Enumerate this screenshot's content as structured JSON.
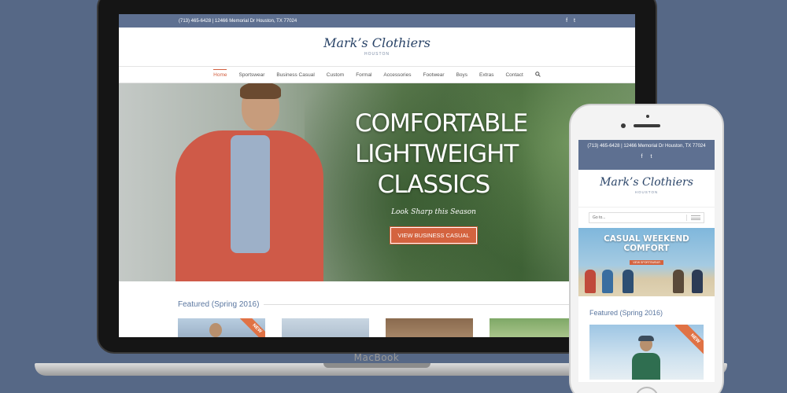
{
  "laptop": {
    "brand": "MacBook",
    "site": {
      "contact": "(713) 465-6428 | 12466 Memorial Dr Houston, TX 77024",
      "social": [
        "f",
        "t"
      ],
      "logo_name": "Mark’s Clothiers",
      "logo_sub": "HOUSTON",
      "nav": [
        "Home",
        "Sportswear",
        "Business Casual",
        "Custom",
        "Formal",
        "Accessories",
        "Footwear",
        "Boys",
        "Extras",
        "Contact"
      ],
      "active_nav": "Home",
      "hero": {
        "line1": "COMFORTABLE",
        "line2": "LIGHTWEIGHT",
        "line3": "CLASSICS",
        "subtitle": "Look Sharp this Season",
        "button": "VIEW BUSINESS CASUAL"
      },
      "featured_title": "Featured (Spring 2016)",
      "ribbon": "NEW"
    }
  },
  "phone": {
    "site": {
      "contact": "(713) 465-6428 | 12466 Memorial Dr Houston, TX 77024",
      "social": [
        "f",
        "t"
      ],
      "logo_name": "Mark’s Clothiers",
      "logo_sub": "HOUSTON",
      "goto_placeholder": "Go to...",
      "hero": {
        "line1": "CASUAL WEEKEND",
        "line2": "COMFORT",
        "button": "VIEW SPORTSWEAR"
      },
      "featured_title": "Featured (Spring 2016)",
      "ribbon": "NEW"
    }
  },
  "colors": {
    "background": "#566886",
    "topbar": "#5e7091",
    "accent": "#d4633f",
    "logo": "#2a4468",
    "featured": "#5b77a0"
  }
}
